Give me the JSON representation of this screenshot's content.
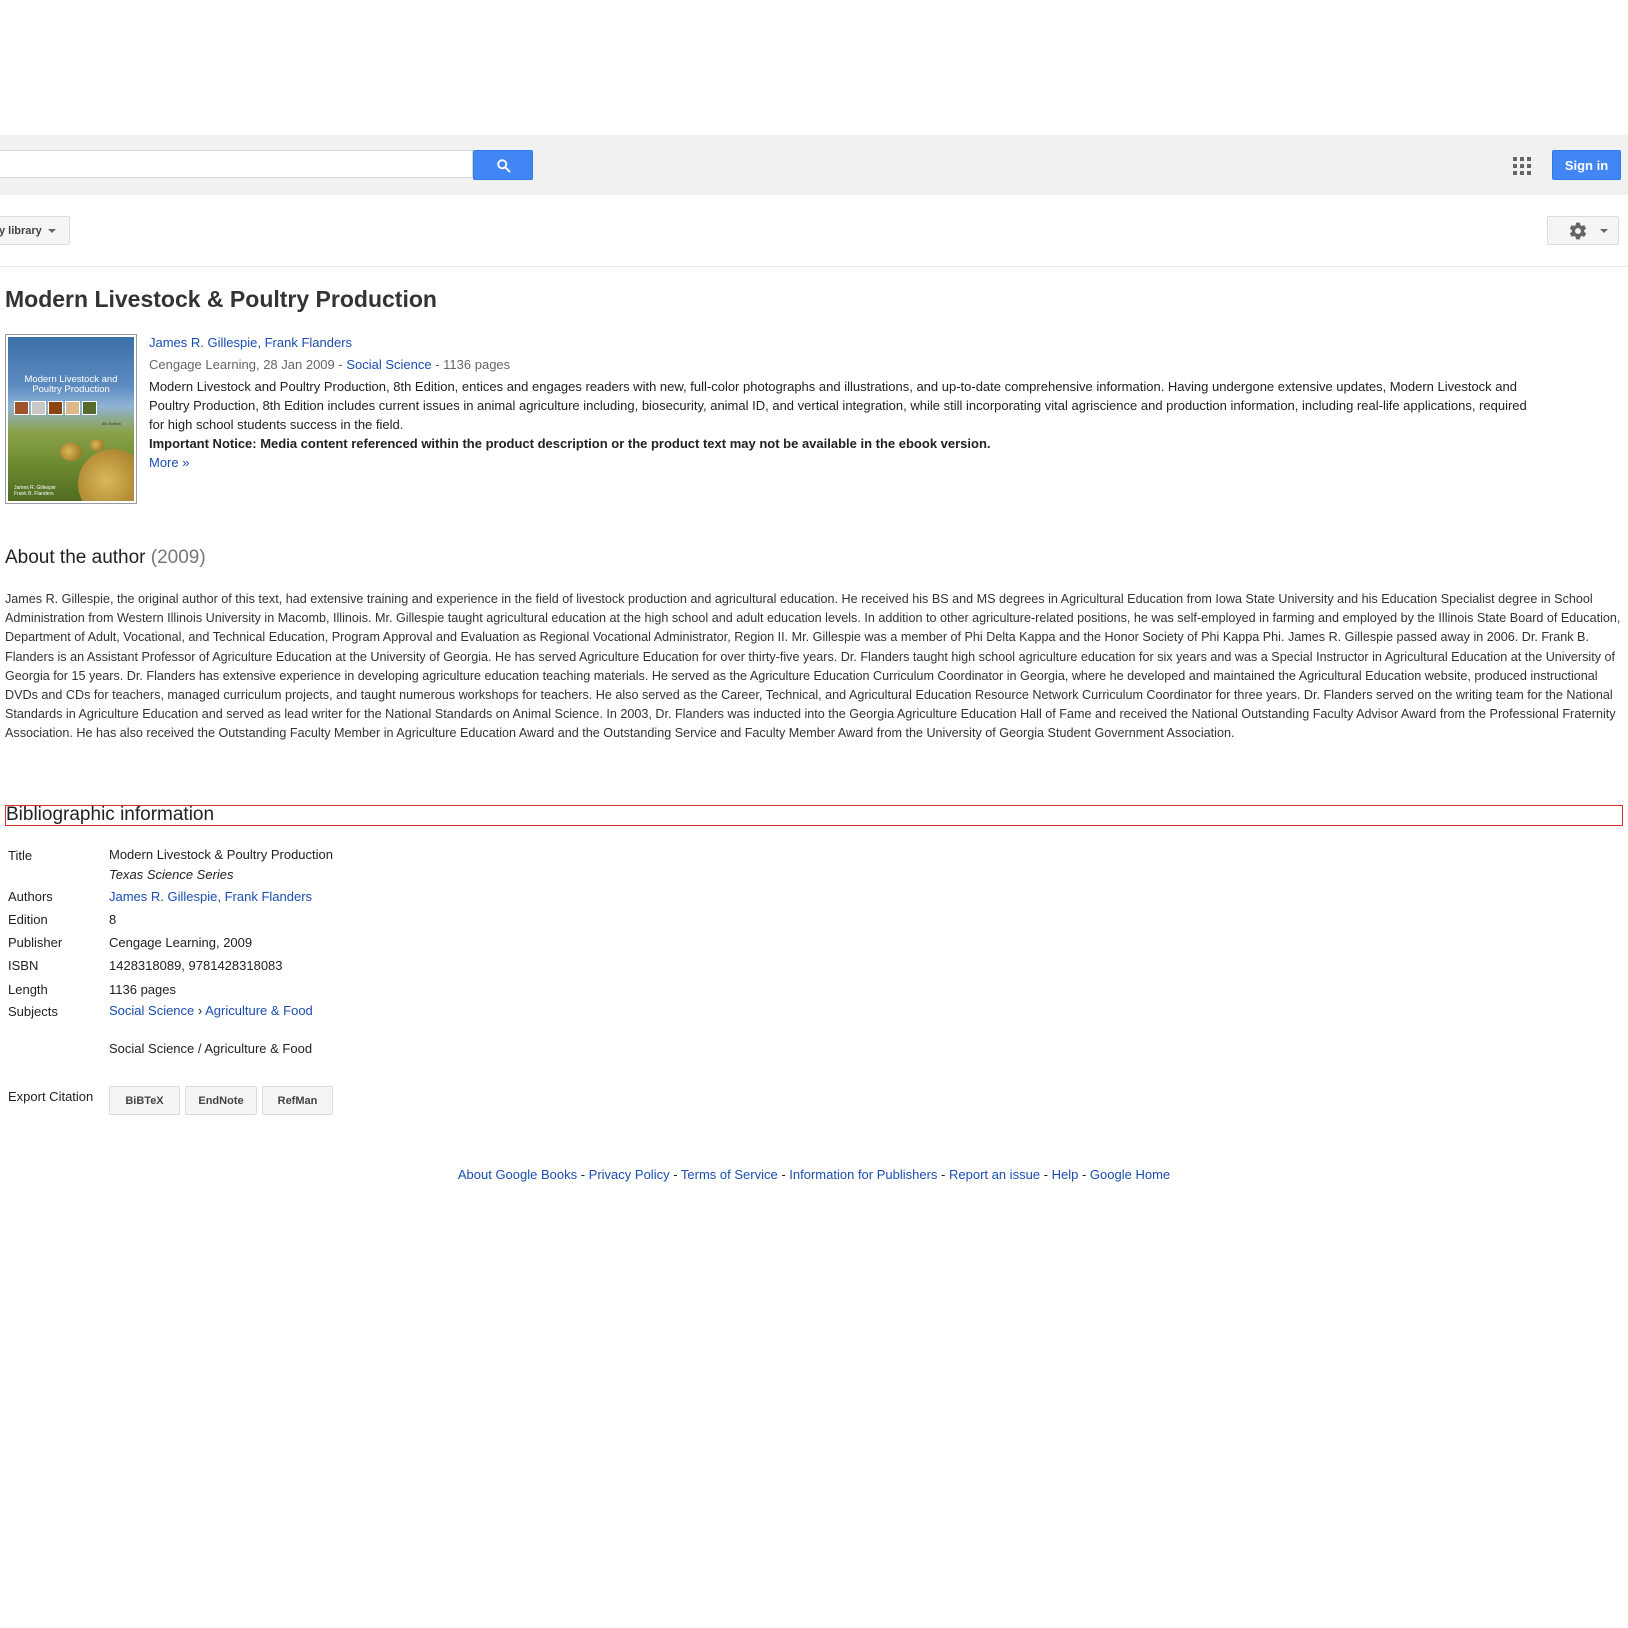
{
  "search": {
    "value": "",
    "placeholder": ""
  },
  "header": {
    "signin_label": "Sign in"
  },
  "toolbar": {
    "library_label": "y library"
  },
  "book": {
    "title": "Modern Livestock & Poultry Production",
    "author1": "James R. Gillespie",
    "author_sep": ", ",
    "author2": "Frank Flanders",
    "publisher_date": "Cengage Learning, 28 Jan 2009",
    "dash1": " - ",
    "category": "Social Science",
    "pages_text": " - 1136 pages",
    "description": "Modern Livestock and Poultry Production, 8th Edition, entices and engages readers with new, full-color photographs and illustrations, and up-to-date comprehensive information. Having undergone extensive updates, Modern Livestock and Poultry Production, 8th Edition includes current issues in animal agriculture including, biosecurity, animal ID, and vertical integration, while still incorporating vital agriscience and production information, including real-life applications, required for high school students success in the field.",
    "notice": "Important Notice: Media content referenced within the product description or the product text may not be available in the ebook version.",
    "more_label": "More »",
    "cover": {
      "title_line1": "Modern Livestock and",
      "title_line2": "Poultry Production",
      "edition": "8th Edition",
      "author_line1": "James R. Gillespie",
      "author_line2": "Frank B. Flanders"
    }
  },
  "about": {
    "heading": "About the author",
    "year": "(2009)",
    "text": "James R. Gillespie, the original author of this text, had extensive training and experience in the field of livestock production and agricultural education. He received his BS and MS degrees in Agricultural Education from Iowa State University and his Education Specialist degree in School Administration from Western Illinois University in Macomb, Illinois. Mr. Gillespie taught agricultural education at the high school and adult education levels. In addition to other agriculture-related positions, he was self-employed in farming and employed by the Illinois State Board of Education, Department of Adult, Vocational, and Technical Education, Program Approval and Evaluation as Regional Vocational Administrator, Region II. Mr. Gillespie was a member of Phi Delta Kappa and the Honor Society of Phi Kappa Phi. James R. Gillespie passed away in 2006. Dr. Frank B. Flanders is an Assistant Professor of Agriculture Education at the University of Georgia. He has served Agriculture Education for over thirty-five years. Dr. Flanders taught high school agriculture education for six years and was a Special Instructor in Agricultural Education at the University of Georgia for 15 years. Dr. Flanders has extensive experience in developing agriculture education teaching materials. He served as the Agriculture Education Curriculum Coordinator in Georgia, where he developed and maintained the Agricultural Education website, produced instructional DVDs and CDs for teachers, managed curriculum projects, and taught numerous workshops for teachers. He also served as the Career, Technical, and Agricultural Education Resource Network Curriculum Coordinator for three years. Dr. Flanders served on the writing team for the National Standards in Agriculture Education and served as lead writer for the National Standards on Animal Science. In 2003, Dr. Flanders was inducted into the Georgia Agriculture Education Hall of Fame and received the National Outstanding Faculty Advisor Award from the Professional Fraternity Association. He has also received the Outstanding Faculty Member in Agriculture Education Award and the Outstanding Service and Faculty Member Award from the University of Georgia Student Government Association."
  },
  "biblio": {
    "heading": "Bibliographic information",
    "title_label": "Title",
    "title_value": "Modern Livestock & Poultry Production",
    "series": "Texas Science Series",
    "authors_label": "Authors",
    "author1": "James R. Gillespie",
    "author_sep": ", ",
    "author2": "Frank Flanders",
    "edition_label": "Edition",
    "edition_value": "8",
    "publisher_label": "Publisher",
    "publisher_value": "Cengage Learning, 2009",
    "isbn_label": "ISBN",
    "isbn_value": "1428318089, 9781428318083",
    "length_label": "Length",
    "length_value": "1136 pages",
    "subjects_label": "Subjects",
    "subject_a1": "Social Science",
    "subject_arrow": " › ",
    "subject_a2": "Agriculture & Food",
    "subject_b": "Social Science / Agriculture & Food",
    "export_label": "Export Citation",
    "citations": [
      "BiBTeX",
      "EndNote",
      "RefMan"
    ]
  },
  "footer": {
    "links": [
      "About Google Books",
      "Privacy Policy",
      "Terms of Service",
      "Information for Publishers",
      "Report an issue",
      "Help",
      "Google Home"
    ],
    "sep": " - "
  },
  "colors": {
    "link": "#1a4db0",
    "button_blue": "#4285f4",
    "highlight": "#d93025"
  },
  "icons": [
    "search-icon",
    "apps-grid-icon",
    "gear-icon",
    "caret-down-icon"
  ]
}
